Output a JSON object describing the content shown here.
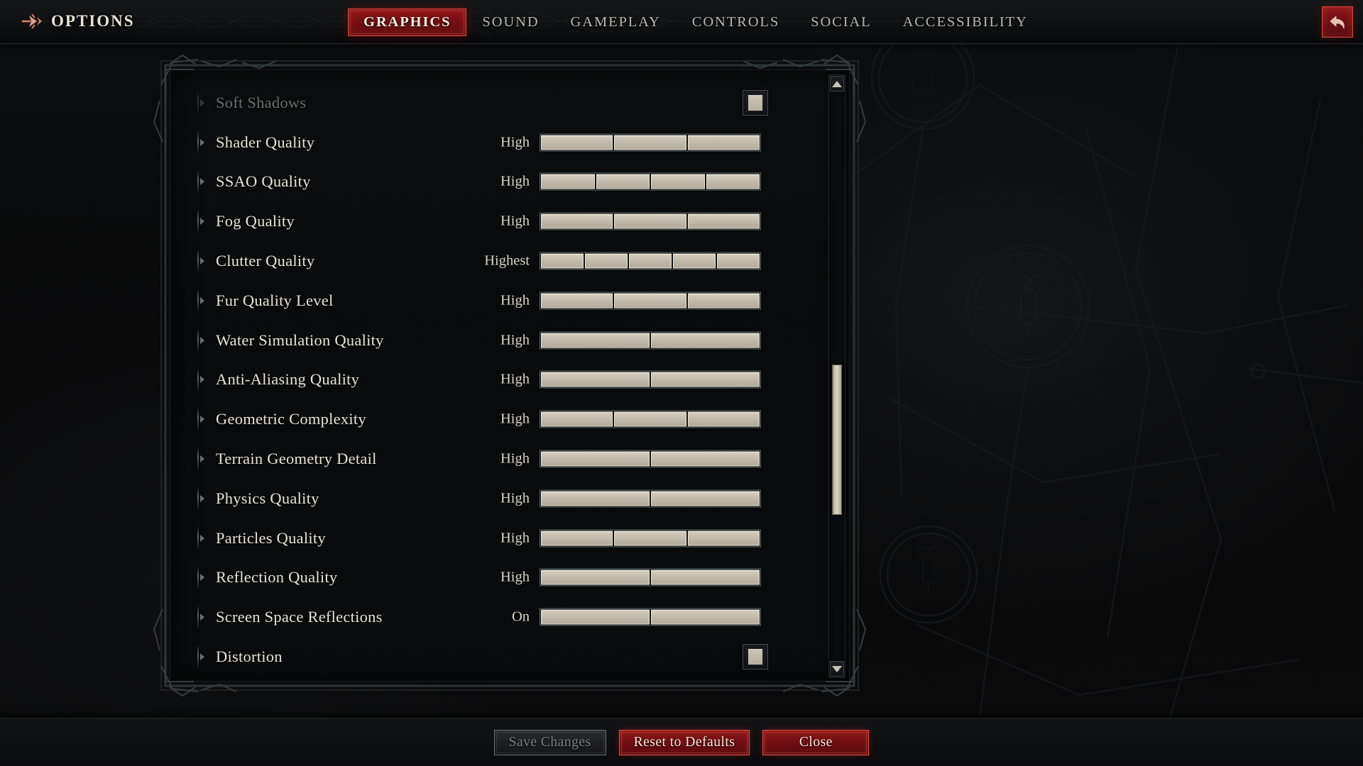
{
  "header": {
    "brand_label": "OPTIONS",
    "brand_icon": "arrow-right-flare-icon",
    "back_icon": "back-arrow-icon",
    "tabs": [
      {
        "label": "GRAPHICS",
        "active": true
      },
      {
        "label": "SOUND",
        "active": false
      },
      {
        "label": "GAMEPLAY",
        "active": false
      },
      {
        "label": "CONTROLS",
        "active": false
      },
      {
        "label": "SOCIAL",
        "active": false
      },
      {
        "label": "ACCESSIBILITY",
        "active": false
      }
    ]
  },
  "settings": {
    "rows": [
      {
        "label": "Soft Shadows",
        "type": "checkbox",
        "checked": true,
        "dim": true
      },
      {
        "label": "Shader Quality",
        "type": "slider",
        "value": "High",
        "segments": 3,
        "filled": 3
      },
      {
        "label": "SSAO Quality",
        "type": "slider",
        "value": "High",
        "segments": 4,
        "filled": 4
      },
      {
        "label": "Fog Quality",
        "type": "slider",
        "value": "High",
        "segments": 3,
        "filled": 3
      },
      {
        "label": "Clutter Quality",
        "type": "slider",
        "value": "Highest",
        "segments": 5,
        "filled": 5
      },
      {
        "label": "Fur Quality Level",
        "type": "slider",
        "value": "High",
        "segments": 3,
        "filled": 3
      },
      {
        "label": "Water Simulation Quality",
        "type": "slider",
        "value": "High",
        "segments": 2,
        "filled": 2
      },
      {
        "label": "Anti-Aliasing Quality",
        "type": "slider",
        "value": "High",
        "segments": 2,
        "filled": 2
      },
      {
        "label": "Geometric Complexity",
        "type": "slider",
        "value": "High",
        "segments": 3,
        "filled": 3
      },
      {
        "label": "Terrain Geometry Detail",
        "type": "slider",
        "value": "High",
        "segments": 2,
        "filled": 2
      },
      {
        "label": "Physics Quality",
        "type": "slider",
        "value": "High",
        "segments": 2,
        "filled": 2
      },
      {
        "label": "Particles Quality",
        "type": "slider",
        "value": "High",
        "segments": 3,
        "filled": 3
      },
      {
        "label": "Reflection Quality",
        "type": "slider",
        "value": "High",
        "segments": 2,
        "filled": 2
      },
      {
        "label": "Screen Space Reflections",
        "type": "slider",
        "value": "On",
        "segments": 2,
        "filled": 2
      },
      {
        "label": "Distortion",
        "type": "checkbox",
        "checked": true,
        "dim": false
      }
    ]
  },
  "scrollbar": {
    "up_icon": "chevron-up-icon",
    "down_icon": "chevron-down-icon",
    "thumb_position_percent": 65
  },
  "footer": {
    "buttons": [
      {
        "label": "Save Changes",
        "style": "disabled"
      },
      {
        "label": "Reset to Defaults",
        "style": "danger"
      },
      {
        "label": "Close",
        "style": "danger"
      }
    ]
  },
  "colors": {
    "accent_red": "#8c1418",
    "accent_red_border": "#d24b44",
    "text_primary": "#e9e4d7",
    "text_dim": "#6d6e6b",
    "slider_fill": "#c3bbac",
    "slider_track": "#162022",
    "slider_border": "#5e6a6c",
    "background": "#080809"
  }
}
